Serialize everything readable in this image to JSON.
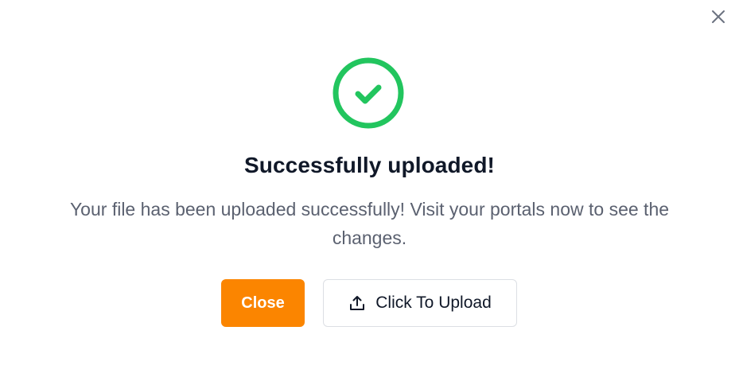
{
  "dialog": {
    "close_icon": "close-icon",
    "status_icon": "check-circle-icon",
    "status_color": "#22c55e",
    "title": "Successfully uploaded!",
    "message": "Your file has been uploaded successfully! Visit your portals now to see the changes.",
    "primary_button": {
      "label": "Close",
      "color": "#fb8500"
    },
    "secondary_button": {
      "label": "Click To Upload",
      "icon": "upload-icon"
    }
  }
}
